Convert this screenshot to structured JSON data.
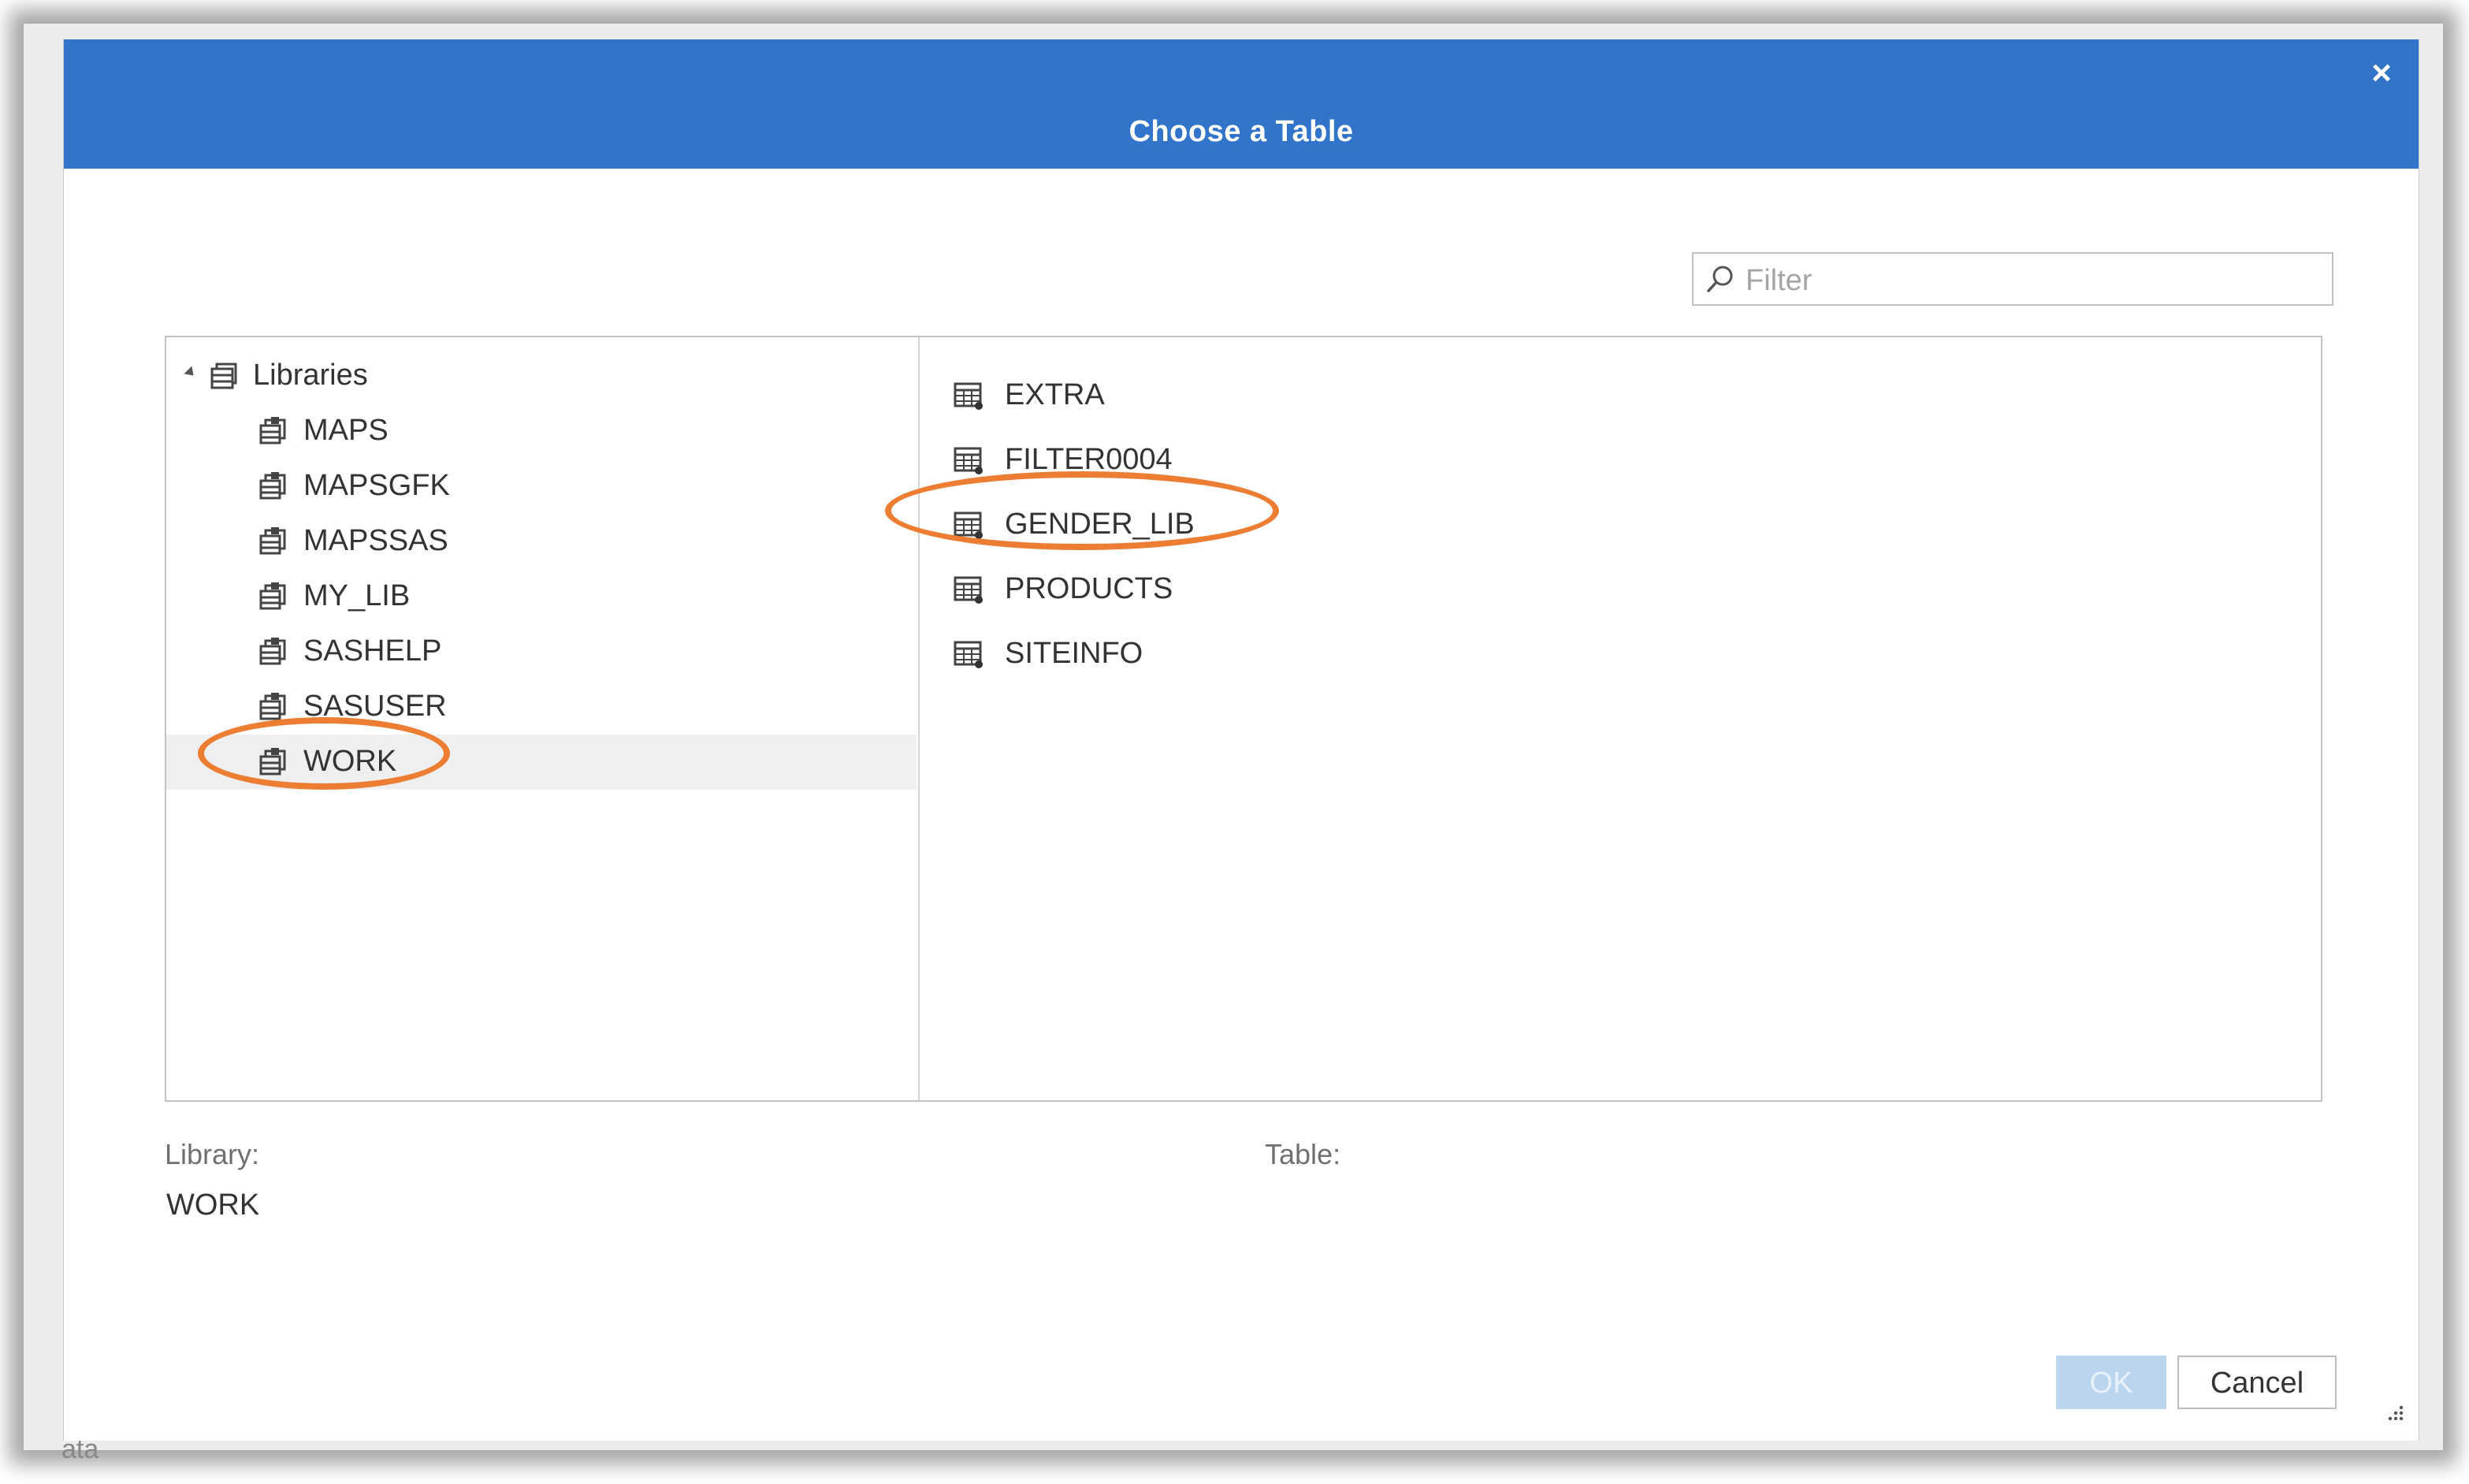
{
  "dialog": {
    "title": "Choose a Table",
    "close_label": "×"
  },
  "filter": {
    "placeholder": "Filter"
  },
  "tree": {
    "root_label": "Libraries",
    "items": [
      {
        "label": "MAPS"
      },
      {
        "label": "MAPSGFK"
      },
      {
        "label": "MAPSSAS"
      },
      {
        "label": "MY_LIB"
      },
      {
        "label": "SASHELP"
      },
      {
        "label": "SASUSER"
      },
      {
        "label": "WORK",
        "selected": true
      }
    ]
  },
  "tables": [
    {
      "label": "EXTRA"
    },
    {
      "label": "FILTER0004"
    },
    {
      "label": "GENDER_LIB",
      "highlighted": true
    },
    {
      "label": "PRODUCTS"
    },
    {
      "label": "SITEINFO"
    }
  ],
  "info": {
    "library_label": "Library:",
    "library_value": "WORK",
    "table_label": "Table:",
    "table_value": ""
  },
  "buttons": {
    "ok": "OK",
    "cancel": "Cancel"
  },
  "background": {
    "footer_text": "ata"
  },
  "colors": {
    "titlebar": "#3174c9",
    "annotation_ring": "#ec7d32",
    "selected_row": "#efefef",
    "ok_disabled": "#bcd5ef"
  },
  "icons": {
    "library": "library-icon",
    "libraries_root": "libraries-icon",
    "table": "table-icon",
    "filter": "search-icon"
  }
}
